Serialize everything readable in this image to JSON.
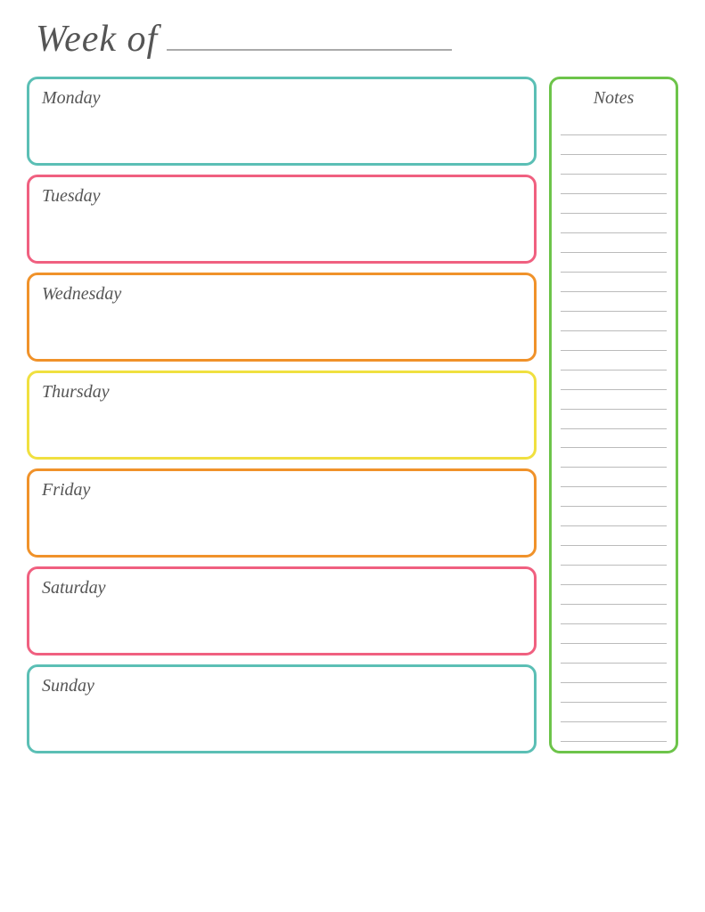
{
  "header": {
    "week_of_text": "Week of",
    "underline_value": ""
  },
  "days": [
    {
      "id": "monday",
      "label": "Monday",
      "css_class": "monday"
    },
    {
      "id": "tuesday",
      "label": "Tuesday",
      "css_class": "tuesday"
    },
    {
      "id": "wednesday",
      "label": "Wednesday",
      "css_class": "wednesday"
    },
    {
      "id": "thursday",
      "label": "Thursday",
      "css_class": "thursday"
    },
    {
      "id": "friday",
      "label": "Friday",
      "css_class": "friday"
    },
    {
      "id": "saturday",
      "label": "Saturday",
      "css_class": "saturday"
    },
    {
      "id": "sunday",
      "label": "Sunday",
      "css_class": "sunday"
    }
  ],
  "notes": {
    "title": "Notes",
    "line_count": 32
  },
  "colors": {
    "monday_border": "#5bbfb5",
    "tuesday_border": "#f06080",
    "wednesday_border": "#f0922a",
    "thursday_border": "#f0e040",
    "friday_border": "#f0922a",
    "saturday_border": "#f06080",
    "sunday_border": "#5bbfb5",
    "notes_border": "#6dc44a"
  }
}
